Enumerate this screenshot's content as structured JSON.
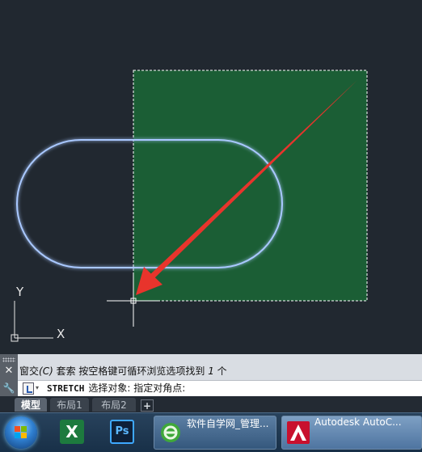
{
  "drawing": {
    "ucs_x_label": "X",
    "ucs_y_label": "Y",
    "selection_fill_color": "#1b5e35",
    "arrow_color": "#e8342c",
    "shape_glow_color": "#8fd4ff"
  },
  "command": {
    "history_prefix": "窗交",
    "history_option": "(C)",
    "history_rest": " 套索  按空格键可循环浏览选项找到 ",
    "history_count": "1",
    "history_unit": " 个",
    "command_name": "STRETCH",
    "prompt": "选择对象: 指定对角点:"
  },
  "tabs": [
    {
      "label": "模型",
      "active": true
    },
    {
      "label": "布局1",
      "active": false
    },
    {
      "label": "布局2",
      "active": false
    }
  ],
  "tab_add_label": "+",
  "taskbar": {
    "excel_glyph": "X",
    "ps_glyph": "Ps",
    "browser_label": "软件自学网_管理...",
    "autocad_label": "Autodesk AutoC..."
  }
}
